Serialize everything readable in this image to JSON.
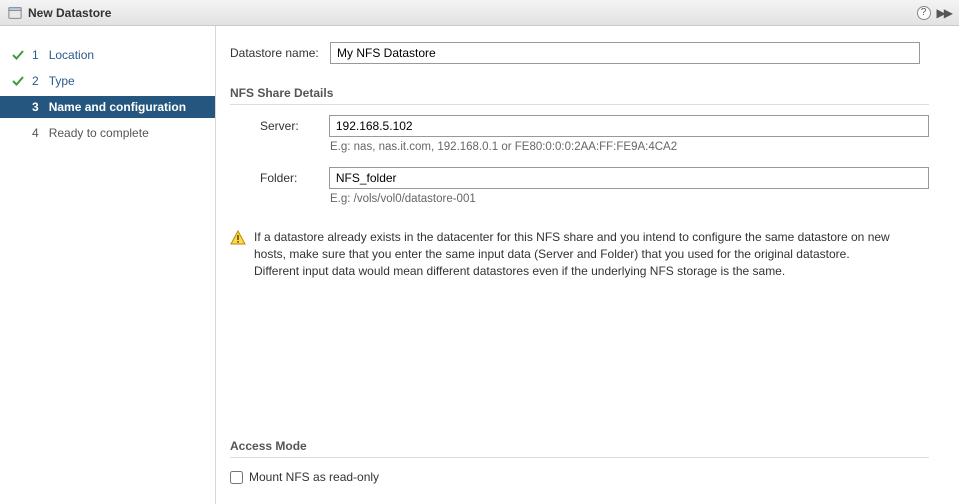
{
  "title": "New Datastore",
  "sidebar": {
    "steps": [
      {
        "num": "1",
        "label": "Location",
        "state": "done"
      },
      {
        "num": "2",
        "label": "Type",
        "state": "done"
      },
      {
        "num": "3",
        "label": "Name and configuration",
        "state": "active"
      },
      {
        "num": "4",
        "label": "Ready to complete",
        "state": "pending"
      }
    ]
  },
  "form": {
    "datastore_name_label": "Datastore name:",
    "datastore_name_value": "My NFS Datastore",
    "section_nfs": "NFS Share Details",
    "server_label": "Server:",
    "server_value": "192.168.5.102",
    "server_hint": "E.g: nas, nas.it.com, 192.168.0.1 or FE80:0:0:0:2AA:FF:FE9A:4CA2",
    "folder_label": "Folder:",
    "folder_value": "NFS_folder",
    "folder_hint": "E.g: /vols/vol0/datastore-001",
    "warning_line1": "If a datastore already exists in the datacenter for this NFS share and you intend to configure the same datastore on new hosts, make sure that you enter the same input data (Server and Folder) that you used for the original datastore.",
    "warning_line2": "Different input data would mean different datastores even if the underlying NFS storage is the same.",
    "section_access": "Access Mode",
    "readonly_label": "Mount NFS as read-only"
  }
}
